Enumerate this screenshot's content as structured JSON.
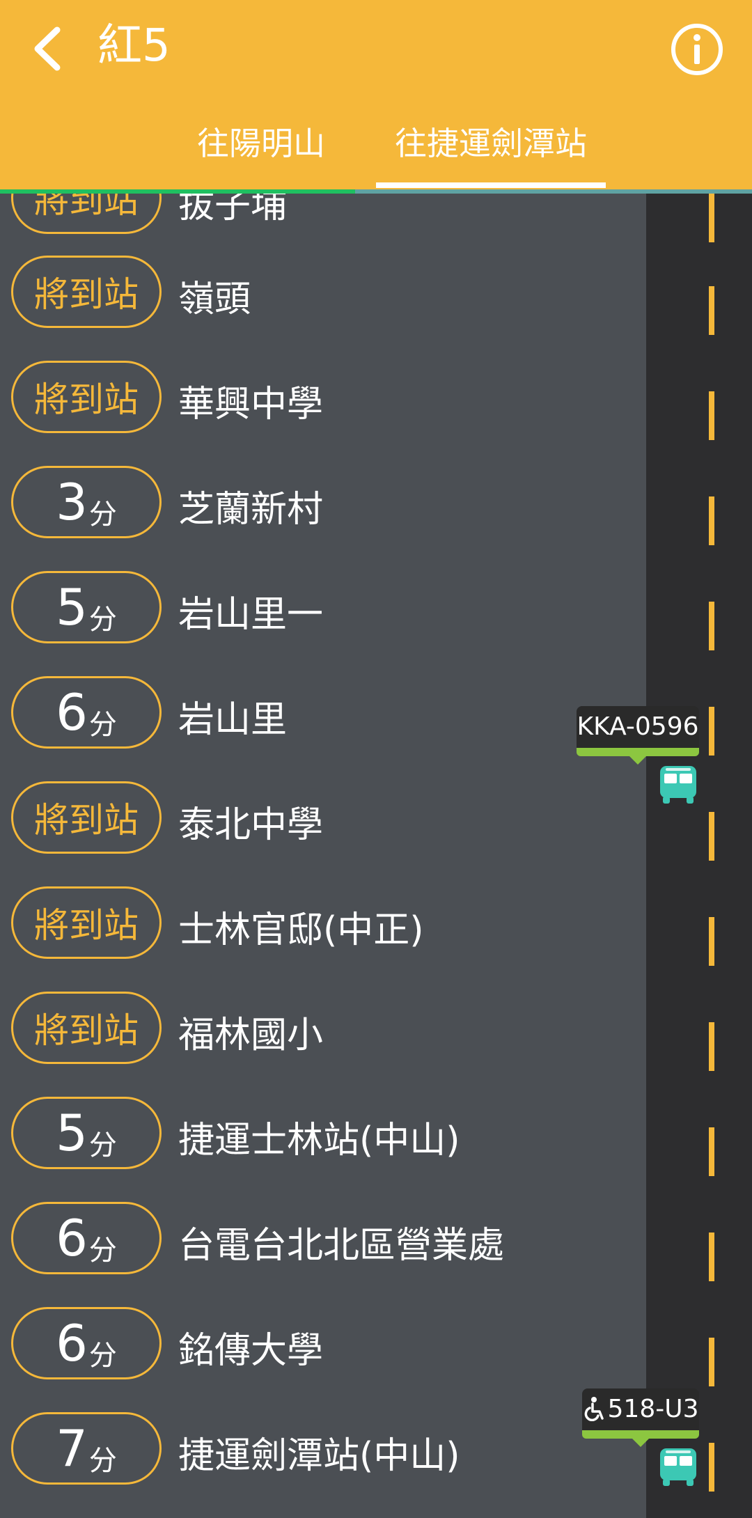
{
  "header": {
    "title": "紅5",
    "back_icon": "chevron-left-icon",
    "info_icon": "info-icon",
    "background": "#f5b83a"
  },
  "tabs": [
    {
      "label": "往陽明山",
      "selected": false
    },
    {
      "label": "往捷運劍潭站",
      "selected": true
    }
  ],
  "accent_colors": {
    "soon": "#f5b83a",
    "progress": "#20c060",
    "bus": "#3cc8b4",
    "bus_tag_bar": "#8cc640"
  },
  "stops": [
    {
      "eta_label": "將到站",
      "eta_minutes": null,
      "name": "拔子埔"
    },
    {
      "eta_label": "將到站",
      "eta_minutes": null,
      "name": "嶺頭"
    },
    {
      "eta_label": "將到站",
      "eta_minutes": null,
      "name": "華興中學"
    },
    {
      "eta_label": null,
      "eta_minutes": "3",
      "eta_unit": "分",
      "name": "芝蘭新村"
    },
    {
      "eta_label": null,
      "eta_minutes": "5",
      "eta_unit": "分",
      "name": "岩山里一"
    },
    {
      "eta_label": null,
      "eta_minutes": "6",
      "eta_unit": "分",
      "name": "岩山里"
    },
    {
      "eta_label": "將到站",
      "eta_minutes": null,
      "name": "泰北中學"
    },
    {
      "eta_label": "將到站",
      "eta_minutes": null,
      "name": "士林官邸(中正)"
    },
    {
      "eta_label": "將到站",
      "eta_minutes": null,
      "name": "福林國小"
    },
    {
      "eta_label": null,
      "eta_minutes": "5",
      "eta_unit": "分",
      "name": "捷運士林站(中山)"
    },
    {
      "eta_label": null,
      "eta_minutes": "6",
      "eta_unit": "分",
      "name": "台電台北北區營業處"
    },
    {
      "eta_label": null,
      "eta_minutes": "6",
      "eta_unit": "分",
      "name": "銘傳大學"
    },
    {
      "eta_label": null,
      "eta_minutes": "7",
      "eta_unit": "分",
      "name": "捷運劍潭站(中山)"
    }
  ],
  "buses": [
    {
      "plate": "KKA-0596",
      "accessible": false,
      "near_stop": "岩山里"
    },
    {
      "plate": "518-U3",
      "accessible": true,
      "accessible_icon": "wheelchair-icon",
      "near_stop": "捷運劍潭站(中山)"
    }
  ]
}
